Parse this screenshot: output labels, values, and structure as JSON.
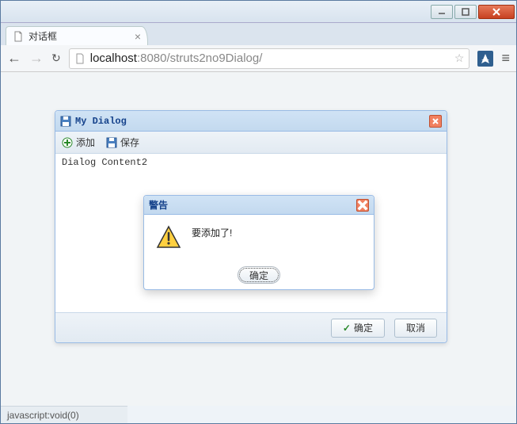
{
  "browser": {
    "tab_title": "对话框",
    "url_host": "localhost",
    "url_port_path": ":8080/struts2no9Dialog/"
  },
  "dialog": {
    "title": "My Dialog",
    "toolbar": {
      "add_label": "添加",
      "save_label": "保存"
    },
    "content": "Dialog Content2",
    "buttons": {
      "ok_label": "确定",
      "cancel_label": "取消"
    }
  },
  "alert": {
    "title": "警告",
    "message": "要添加了!",
    "ok_label": "确定"
  },
  "status": {
    "text": "javascript:void(0)"
  }
}
